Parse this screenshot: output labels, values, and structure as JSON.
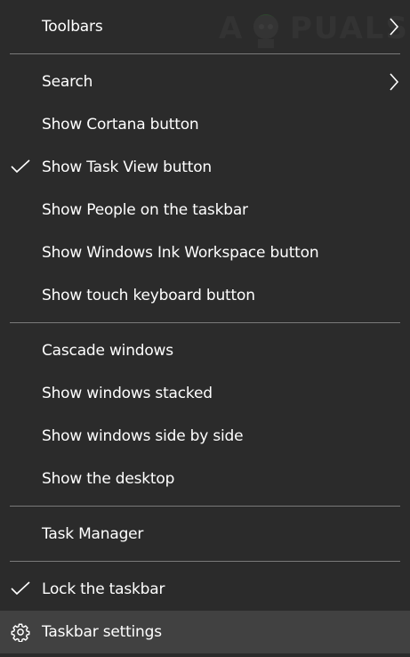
{
  "menu": {
    "items": [
      {
        "label": "Toolbars",
        "checked": false,
        "submenu": true
      },
      {
        "label": "Search",
        "checked": false,
        "submenu": true
      },
      {
        "label": "Show Cortana button",
        "checked": false,
        "submenu": false
      },
      {
        "label": "Show Task View button",
        "checked": true,
        "submenu": false
      },
      {
        "label": "Show People on the taskbar",
        "checked": false,
        "submenu": false
      },
      {
        "label": "Show Windows Ink Workspace button",
        "checked": false,
        "submenu": false
      },
      {
        "label": "Show touch keyboard button",
        "checked": false,
        "submenu": false
      },
      {
        "label": "Cascade windows",
        "checked": false,
        "submenu": false
      },
      {
        "label": "Show windows stacked",
        "checked": false,
        "submenu": false
      },
      {
        "label": "Show windows side by side",
        "checked": false,
        "submenu": false
      },
      {
        "label": "Show the desktop",
        "checked": false,
        "submenu": false
      },
      {
        "label": "Task Manager",
        "checked": false,
        "submenu": false
      },
      {
        "label": "Lock the taskbar",
        "checked": true,
        "submenu": false
      },
      {
        "label": "Taskbar settings",
        "checked": false,
        "submenu": false,
        "icon": "gear-icon",
        "highlighted": true
      }
    ]
  },
  "watermark": {
    "text_left": "A",
    "text_right": "PUALS"
  },
  "colors": {
    "background": "#2b2b2b",
    "highlight": "#414141",
    "separator": "#7a7a7a",
    "text": "#ffffff"
  }
}
